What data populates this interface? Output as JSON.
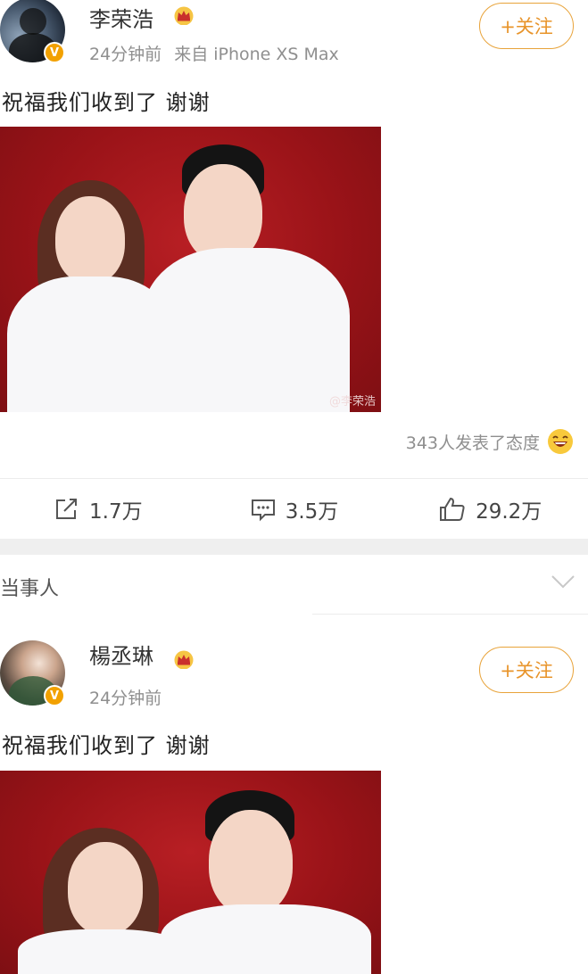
{
  "post1": {
    "username": "李荣浩",
    "verified_badge": "V",
    "time": "24分钟前",
    "source": "来自 iPhone XS Max",
    "follow_label": "+关注",
    "text": "祝福我们收到了 谢谢",
    "photo_watermark": "@李荣浩",
    "reactions_text": "343人发表了态度",
    "actions": {
      "repost": "1.7万",
      "comment": "3.5万",
      "like": "29.2万"
    }
  },
  "section": {
    "title": "当事人"
  },
  "post2": {
    "username": "楊丞琳",
    "verified_badge": "V",
    "time": "24分钟前",
    "follow_label": "+关注",
    "text": "祝福我们收到了 谢谢"
  },
  "icons": {
    "crown": "crown-icon",
    "repost": "share-icon",
    "comment": "comment-icon",
    "like": "thumbs-up-icon",
    "emoji": "laughing-emoji-icon",
    "chevron": "chevron-down-icon"
  },
  "colors": {
    "accent_orange": "#e8942a",
    "photo_red": "#a0161b",
    "muted_text": "#8f8f8f"
  }
}
